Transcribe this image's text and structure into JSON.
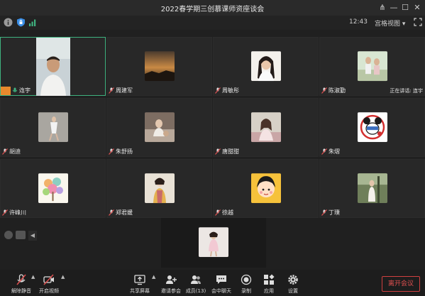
{
  "window": {
    "title": "2022春学期三创慕课师资座谈会"
  },
  "infobar": {
    "time": "12:43",
    "view_label": "宫格视图 ▾"
  },
  "participants": [
    {
      "name": "连宇",
      "speaking": true
    },
    {
      "name": "周建军"
    },
    {
      "name": "周敏彤"
    },
    {
      "name": "陈淑勤"
    },
    {
      "name": "胡迪"
    },
    {
      "name": "朱舒扬"
    },
    {
      "name": "唐甜甜"
    },
    {
      "name": "朱熠"
    },
    {
      "name": "许峰川"
    },
    {
      "name": "郑君媛"
    },
    {
      "name": "徐越"
    },
    {
      "name": "丁璞"
    }
  ],
  "speaking_now": "正在讲话: 连宇",
  "toolbar": {
    "unmute": "解除静音",
    "start_video": "开启视频",
    "share": "共享屏幕",
    "invite": "邀请参会",
    "members": "成员(13)",
    "chat": "会中聊天",
    "record": "录制",
    "apps": "应用",
    "settings": "设置",
    "leave": "离开会议"
  },
  "colors": {
    "accent_green": "#3fb27f",
    "leave_red": "#e05050",
    "orange": "#e8892d",
    "mic_blue": "#3a8ee6"
  }
}
